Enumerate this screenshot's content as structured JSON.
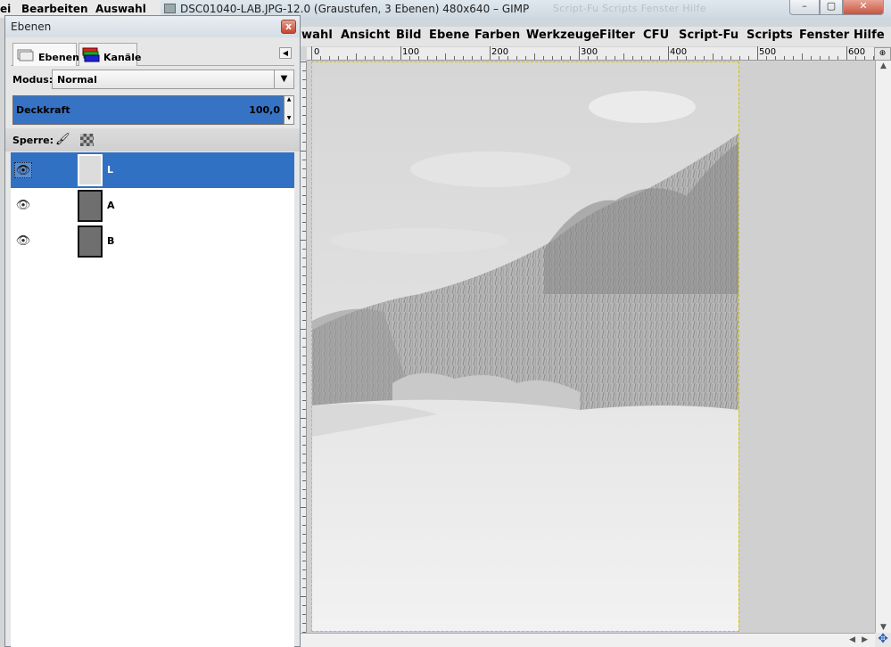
{
  "bg_window": {
    "menu": [
      "ei",
      "Bearbeiten",
      "Auswahl"
    ]
  },
  "main_window": {
    "title": "DSC01040-LAB.JPG-12.0 (Graustufen, 3 Ebenen) 480x640 – GIMP",
    "ghost_menu": "Script-Fu   Scripts   Fenster   Hilfe",
    "controls": {
      "minimize": "–",
      "maximize": "▢",
      "close": "✕"
    },
    "menu": [
      "wahl",
      "Ansicht",
      "Bild",
      "Ebene",
      "Farben",
      "Werkzeuge",
      "Filter",
      "CFU",
      "Script-Fu",
      "Scripts",
      "Fenster",
      "Hilfe"
    ],
    "ruler_labels": [
      "0",
      "100",
      "200",
      "300",
      "400",
      "500",
      "600"
    ],
    "corner_icon": "zoom-icon",
    "nav_icon": "navigate-icon"
  },
  "layers_dock": {
    "title": "Ebenen",
    "close": "x",
    "tabs": [
      {
        "label": "Ebenen",
        "icon": "layers-icon"
      },
      {
        "label": "Kanäle",
        "icon": "channels-icon"
      }
    ],
    "mode_label": "Modus:",
    "mode_value": "Normal",
    "opacity_label": "Deckkraft",
    "opacity_value": "100,0",
    "lock_label": "Sperre:",
    "layers": [
      {
        "name": "L",
        "selected": true,
        "visible": true
      },
      {
        "name": "A",
        "selected": false,
        "visible": true
      },
      {
        "name": "B",
        "selected": false,
        "visible": true
      }
    ]
  },
  "colors": {
    "selection": "#3171c4",
    "opacity_fill": "#3773c5"
  }
}
